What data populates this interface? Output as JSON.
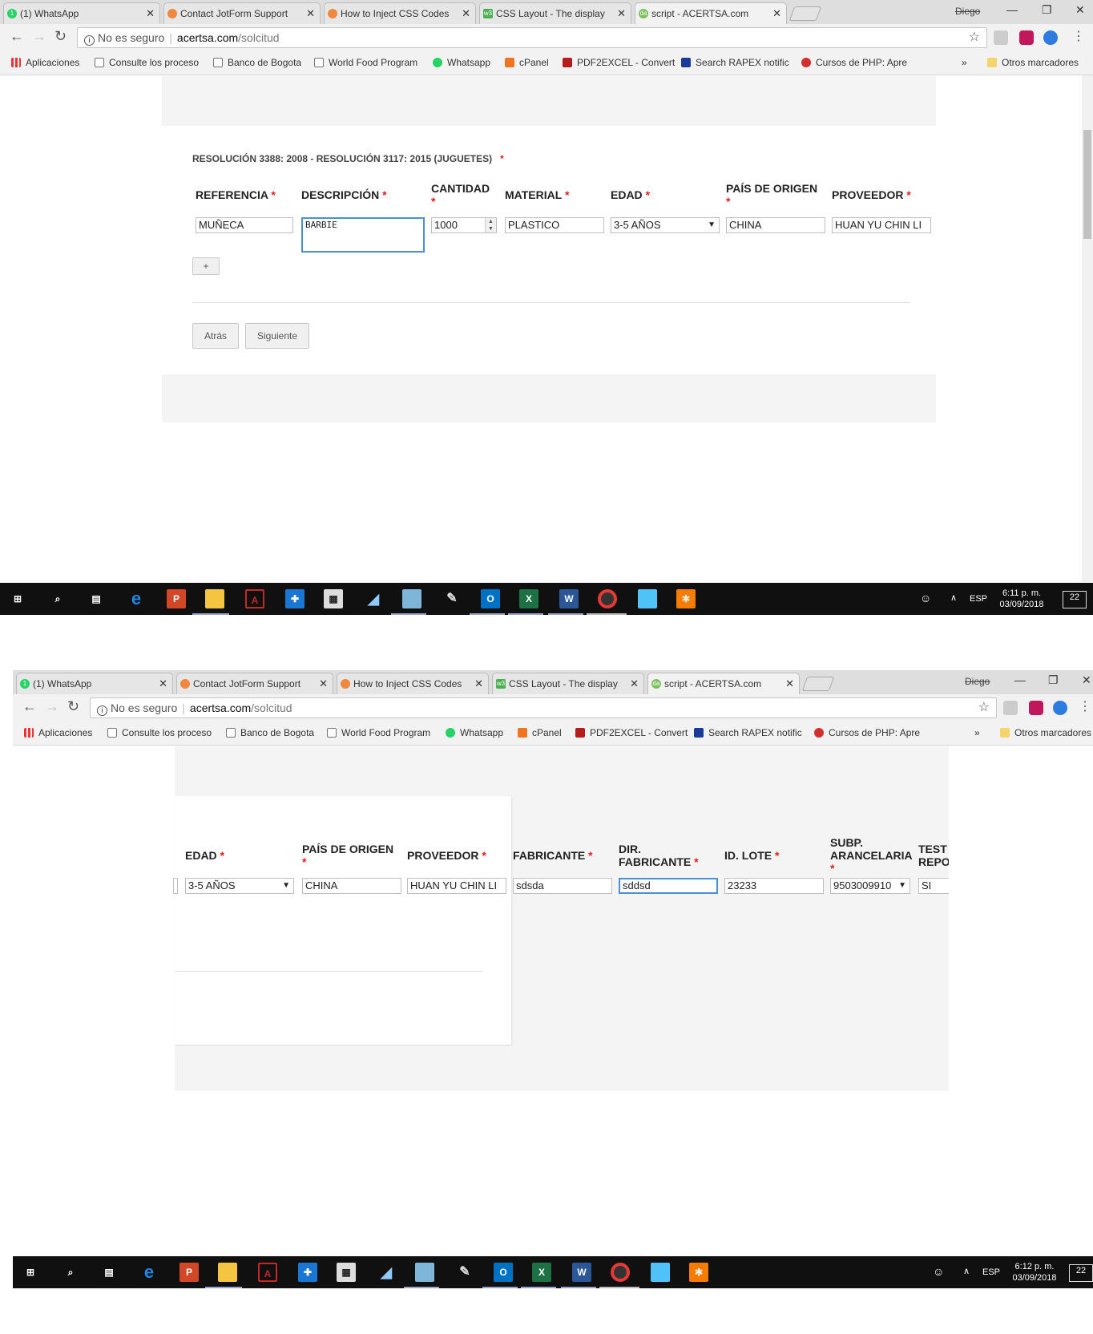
{
  "tabs": [
    {
      "label": "(1) WhatsApp",
      "icon": "whatsapp-icon"
    },
    {
      "label": "Contact JotForm Support",
      "icon": "jotform-icon"
    },
    {
      "label": "How to Inject CSS Codes",
      "icon": "jotform-icon"
    },
    {
      "label": "CSS Layout - The display",
      "icon": "w3schools-icon"
    },
    {
      "label": "script - ACERTSA.com",
      "icon": "acertsa-icon"
    }
  ],
  "user_name": "Diego",
  "address": {
    "insecure": "No es seguro",
    "host": "acertsa.com",
    "path": "/solcitud"
  },
  "bookmarks": [
    {
      "label": "Aplicaciones",
      "icon": "apps-grid-icon"
    },
    {
      "label": "Consulte los proceso",
      "icon": "page-icon"
    },
    {
      "label": "Banco de Bogota",
      "icon": "page-icon"
    },
    {
      "label": "World Food Program",
      "icon": "page-icon"
    },
    {
      "label": "Whatsapp",
      "icon": "whatsapp-icon"
    },
    {
      "label": "cPanel",
      "icon": "cpanel-icon"
    },
    {
      "label": "PDF2EXCEL - Convert",
      "icon": "pdf-icon"
    },
    {
      "label": "Search RAPEX notific",
      "icon": "eu-flag-icon"
    },
    {
      "label": "Cursos de PHP: Apre",
      "icon": "s-logo-icon"
    }
  ],
  "bookmarks_more": "»",
  "other_bookmarks": "Otros marcadores",
  "form": {
    "section_title": "RESOLUCIÓN 3388: 2008 - RESOLUCIÓN 3117: 2015 (JUGUETES)",
    "required_mark": "*",
    "headers": {
      "referencia": "REFERENCIA",
      "descripcion": "DESCRIPCIÓN",
      "cantidad": "CANTIDAD",
      "material": "MATERIAL",
      "edad": "EDAD",
      "pais_1": "PAÍS DE ORIGEN",
      "proveedor": "PROVEEDOR",
      "fabricante": "FABRICANTE",
      "dir_1": "DIR.",
      "dir_2": "FABRICANTE",
      "lote": "ID. LOTE",
      "subp_1": "SUBP.",
      "subp_2": "ARANCELARIA",
      "test_1": "TEST",
      "test_2": "REPO"
    },
    "values": {
      "referencia": "MUÑECA",
      "descripcion": "BARBIE",
      "cantidad": "1000",
      "material": "PLASTICO",
      "edad": "3-5 AÑOS",
      "pais": "CHINA",
      "proveedor": "HUAN YU CHIN LI",
      "fabricante": "sdsda",
      "dir_fabricante": "sddsd",
      "lote": "23233",
      "subp": "9503009910",
      "test": "SI"
    },
    "add_row": "+",
    "back": "Atrás",
    "next": "Siguiente"
  },
  "taskbar": {
    "lang": "ESP",
    "shot1": {
      "time": "6:11 p. m.",
      "date": "03/09/2018"
    },
    "shot2": {
      "time": "6:12 p. m.",
      "date": "03/09/2018"
    },
    "notif_count": "22"
  },
  "colors": {
    "required": "#e02020",
    "focus": "#4a90d9",
    "taskbar": "#101010"
  }
}
